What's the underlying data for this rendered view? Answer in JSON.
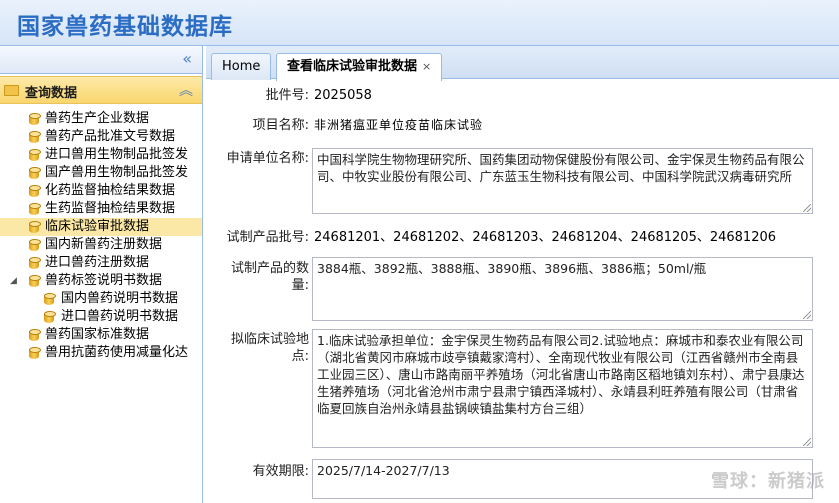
{
  "header": {
    "title": "国家兽药基础数据库"
  },
  "sidebar": {
    "collapse_icon": "double-chevron-left-icon",
    "section_label": "查询数据",
    "items": [
      {
        "label": "兽药生产企业数据"
      },
      {
        "label": "兽药产品批准文号数据"
      },
      {
        "label": "进口兽用生物制品批签发"
      },
      {
        "label": "国产兽用生物制品批签发"
      },
      {
        "label": "化药监督抽检结果数据"
      },
      {
        "label": "生药监督抽检结果数据"
      },
      {
        "label": "临床试验审批数据",
        "selected": true
      },
      {
        "label": "国内新兽药注册数据"
      },
      {
        "label": "进口兽药注册数据"
      },
      {
        "label": "兽药标签说明书数据"
      },
      {
        "label": "国内兽药说明书数据"
      },
      {
        "label": "进口兽药说明书数据"
      },
      {
        "label": "兽药国家标准数据"
      },
      {
        "label": "兽用抗菌药使用减量化达"
      }
    ]
  },
  "tabs": [
    {
      "label": "Home"
    },
    {
      "label": "查看临床试验审批数据",
      "close": "×"
    }
  ],
  "form": {
    "batch_no": {
      "label": "批件号:",
      "value": "2025058"
    },
    "project_name": {
      "label": "项目名称:",
      "value": "非洲猪瘟亚单位疫苗临床试验"
    },
    "applicant": {
      "label": "申请单位名称:",
      "value": "中国科学院生物物理研究所、国药集团动物保健股份有限公司、金宇保灵生物药品有限公司、中牧实业股份有限公司、广东蓝玉生物科技有限公司、中国科学院武汉病毒研究所"
    },
    "product_batch": {
      "label": "试制产品批号:",
      "value": "24681201、24681202、24681203、24681204、24681205、24681206"
    },
    "product_qty": {
      "label": "试制产品的数量:",
      "value": "3884瓶、3892瓶、3888瓶、3890瓶、3896瓶、3886瓶；50ml/瓶"
    },
    "trial_site": {
      "label": "拟临床试验地点:",
      "value": "1.临床试验承担单位：金宇保灵生物药品有限公司2.试验地点：麻城市和泰农业有限公司（湖北省黄冈市麻城市歧亭镇戴家湾村）、全南现代牧业有限公司（江西省赣州市全南县工业园三区）、唐山市路南丽平养殖场（河北省唐山市路南区稻地镇刘东村）、肃宁县康达生猪养殖场（河北省沧州市肃宁县肃宁镇西泽城村）、永靖县利旺养殖有限公司（甘肃省临夏回族自治州永靖县盐锅峡镇盐集村方台三组）"
    },
    "validity": {
      "label": "有效期限:",
      "value": "2025/7/14-2027/7/13"
    }
  },
  "watermark": "雪球：新猪派"
}
